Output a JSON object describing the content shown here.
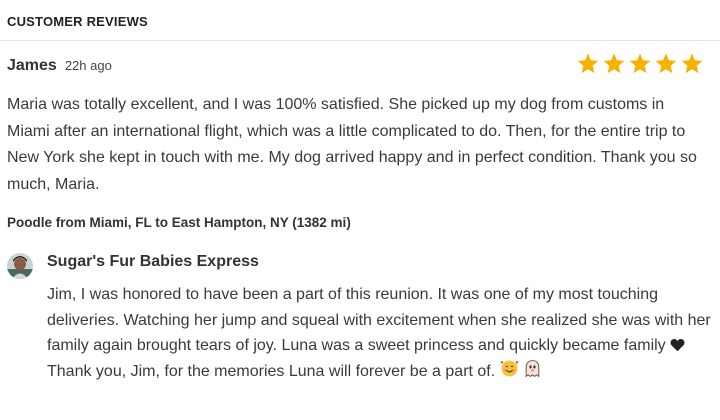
{
  "section": {
    "title": "CUSTOMER REVIEWS"
  },
  "review": {
    "reviewer": "James",
    "time": "22h ago",
    "rating": 5,
    "rating_max": 5,
    "star_color": "#f5b300",
    "text": "Maria was totally excellent, and I was 100% satisfied. She picked up my dog from customs in Miami after an international flight, which was a little complicated to do. Then, for the entire trip to New York she kept in touch with me. My dog arrived happy and in perfect condition. Thank you so much, Maria.",
    "route": "Poodle from Miami, FL to East Hampton, NY (1382 mi)"
  },
  "reply": {
    "author": "Sugar's Fur Babies Express",
    "avatar_icon": "profile-photo",
    "text_part1": "Jim, I was honored to have been a part of this reunion. It was one of my most touching deliveries. Watching her jump and squeal with excitement when she realized she was with her family again brought tears of joy. Luna was a sweet princess and quickly became family",
    "heart_icon": "black-heart-icon",
    "text_part2": "Thank you, Jim, for the memories Luna will forever be a part of.",
    "emoji_icons": [
      "smiling-face-with-hearts-icon",
      "ghost-icon"
    ]
  }
}
